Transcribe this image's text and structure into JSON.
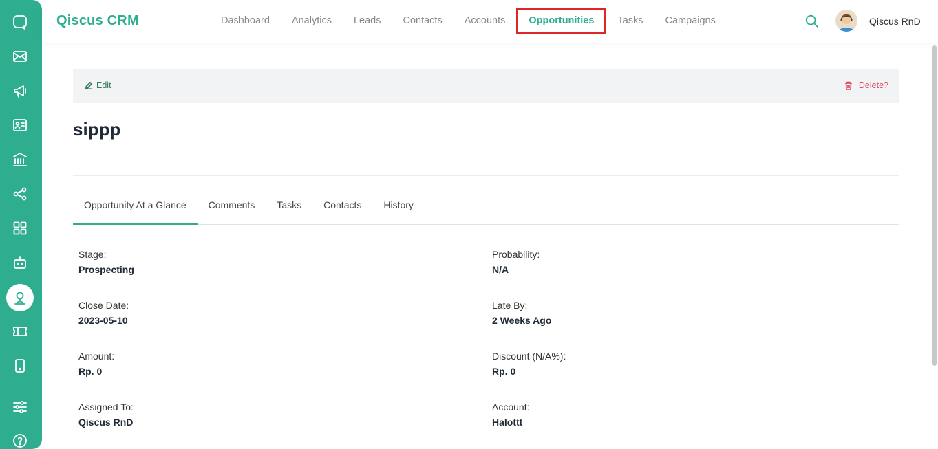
{
  "app": {
    "brand": "Qiscus CRM",
    "accent_color": "#2eae8f",
    "highlight_color": "#e0252a"
  },
  "sidebar": {
    "items": [
      {
        "name": "chat-icon"
      },
      {
        "name": "mail-icon"
      },
      {
        "name": "megaphone-icon"
      },
      {
        "name": "contact-card-icon"
      },
      {
        "name": "bank-icon"
      },
      {
        "name": "share-icon"
      },
      {
        "name": "apps-grid-icon"
      },
      {
        "name": "bot-icon"
      },
      {
        "name": "crm-person-icon",
        "active": true
      },
      {
        "name": "ticket-icon"
      },
      {
        "name": "mobile-icon"
      },
      {
        "name": "settings-sliders-icon"
      },
      {
        "name": "help-icon"
      }
    ]
  },
  "nav": {
    "items": [
      {
        "label": "Dashboard"
      },
      {
        "label": "Analytics"
      },
      {
        "label": "Leads"
      },
      {
        "label": "Contacts"
      },
      {
        "label": "Accounts"
      },
      {
        "label": "Opportunities",
        "active": true
      },
      {
        "label": "Tasks"
      },
      {
        "label": "Campaigns"
      }
    ]
  },
  "user": {
    "name": "Qiscus RnD"
  },
  "actions": {
    "edit_label": "Edit",
    "delete_label": "Delete?"
  },
  "record": {
    "title": "sippp"
  },
  "tabs": [
    {
      "label": "Opportunity At a Glance",
      "active": true
    },
    {
      "label": "Comments"
    },
    {
      "label": "Tasks"
    },
    {
      "label": "Contacts"
    },
    {
      "label": "History"
    }
  ],
  "fields": {
    "stage": {
      "label": "Stage:",
      "value": "Prospecting"
    },
    "probability": {
      "label": "Probability:",
      "value": "N/A"
    },
    "close_date": {
      "label": "Close Date:",
      "value": "2023-05-10"
    },
    "late_by": {
      "label": "Late By:",
      "value": "2 Weeks Ago"
    },
    "amount": {
      "label": "Amount:",
      "value": "Rp. 0"
    },
    "discount": {
      "label": "Discount (N/A%):",
      "value": "Rp. 0"
    },
    "assigned_to": {
      "label": "Assigned To:",
      "value": "Qiscus RnD"
    },
    "account": {
      "label": "Account:",
      "value": "Halottt"
    }
  }
}
